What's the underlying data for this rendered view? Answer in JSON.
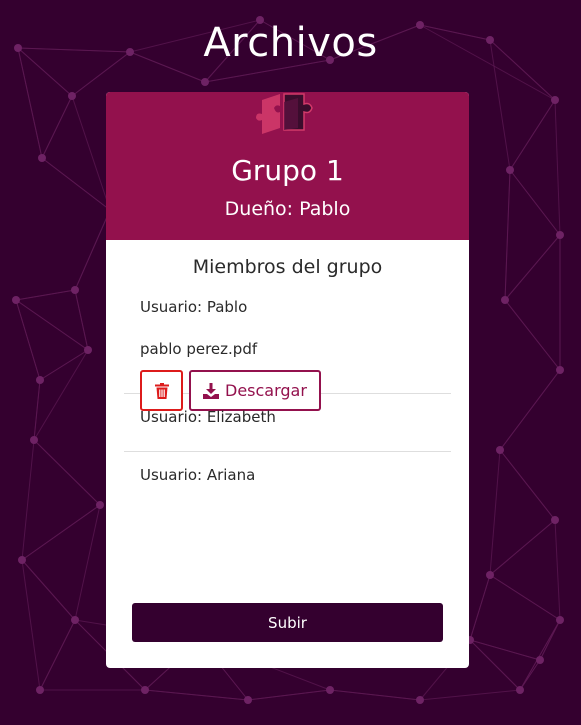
{
  "page": {
    "title": "Archivos",
    "background_color": "#34002f"
  },
  "group": {
    "icon": "puzzle-icon",
    "name": "Grupo 1",
    "owner": "Dueño: Pablo",
    "header_color": "#93114d"
  },
  "members": {
    "heading": "Miembros del grupo",
    "items": [
      {
        "user": "Usuario: Pablo",
        "file": "pablo perez.pdf"
      },
      {
        "user": "Usuario: Elizabeth"
      },
      {
        "user": "Usuario: Ariana"
      }
    ]
  },
  "file_actions": {
    "delete_icon": "trash-icon",
    "download_icon": "download-icon",
    "download_label": "Descargar",
    "delete_color": "#dd1b1b",
    "download_color": "#93114d"
  },
  "upload_button": {
    "label": "Subir",
    "color": "#34002f"
  }
}
